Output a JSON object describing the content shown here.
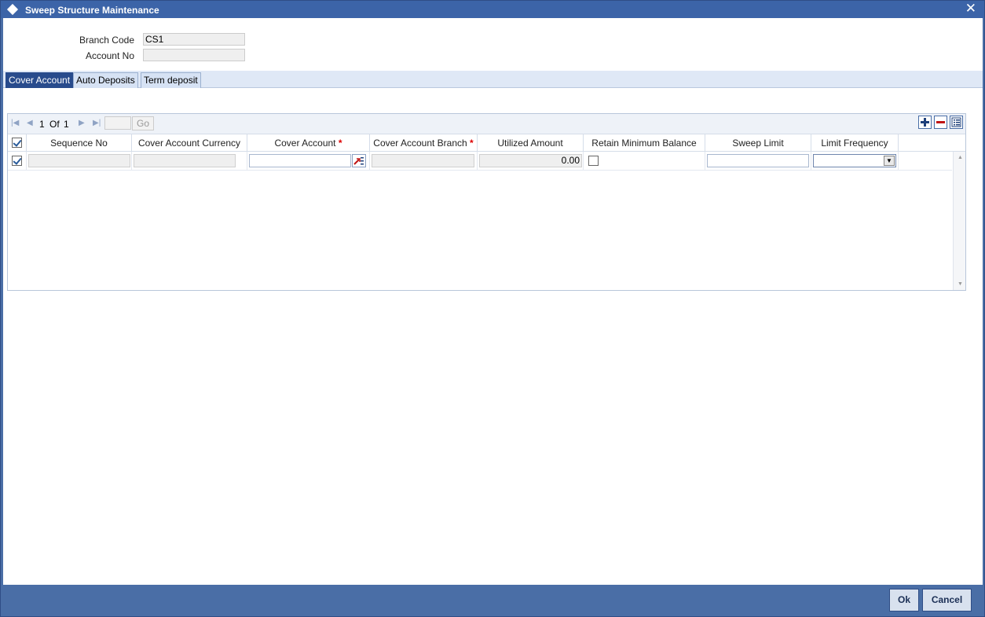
{
  "window": {
    "title": "Sweep Structure Maintenance",
    "close_glyph": "✕"
  },
  "form": {
    "branch_code_label": "Branch Code",
    "branch_code_value": "CS1",
    "account_no_label": "Account No",
    "account_no_value": ""
  },
  "tabs": [
    {
      "label": "Cover Account",
      "active": true
    },
    {
      "label": "Auto Deposits",
      "active": false
    },
    {
      "label": "Term deposit",
      "active": false
    }
  ],
  "pager": {
    "current": "1",
    "of_label": "Of",
    "total": "1",
    "go_label": "Go"
  },
  "grid": {
    "columns": {
      "sequence_no": "Sequence No",
      "cover_account_currency": "Cover Account Currency",
      "cover_account": "Cover Account",
      "cover_account_branch": "Cover Account Branch",
      "utilized_amount": "Utilized Amount",
      "retain_minimum_balance": "Retain Minimum Balance",
      "sweep_limit": "Sweep Limit",
      "limit_frequency": "Limit Frequency"
    },
    "required_marker": "*",
    "rows": [
      {
        "checked": true,
        "sequence_no": "",
        "cover_account_currency": "",
        "cover_account": "",
        "cover_account_branch": "",
        "utilized_amount": "0.00",
        "retain_minimum_balance": false,
        "sweep_limit": "",
        "limit_frequency": ""
      }
    ]
  },
  "buttons": {
    "ok": "Ok",
    "cancel": "Cancel"
  },
  "colors": {
    "title_bar": "#3c64a8",
    "active_tab": "#284b8c",
    "footer": "#4a6ea6",
    "required": "#dd0000"
  }
}
